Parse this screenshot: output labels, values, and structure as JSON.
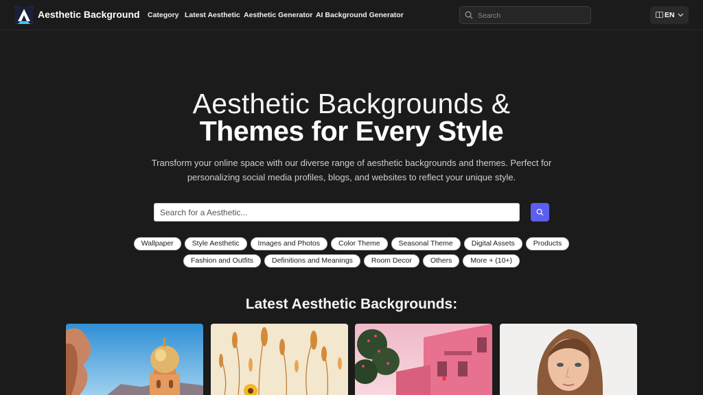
{
  "header": {
    "brand": "Aesthetic Background",
    "nav": [
      "Category",
      "Latest Aesthetic",
      "Aesthetic Generator",
      "AI Background Generator"
    ],
    "search_placeholder": "Search",
    "lang_code": "EN"
  },
  "hero": {
    "line1": "Aesthetic Backgrounds &",
    "line2": "Themes for Every Style",
    "subtitle": "Transform your online space with our diverse range of aesthetic backgrounds and themes. Perfect for personalizing social media profiles, blogs, and websites to reflect your unique style.",
    "search_placeholder": "Search for a Aesthetic..."
  },
  "tags_row1": [
    "Wallpaper",
    "Style Aesthetic",
    "Images and Photos",
    "Color Theme",
    "Seasonal Theme",
    "Digital Assets",
    "Products"
  ],
  "tags_row2": [
    "Fashion and Outfits",
    "Definitions and Meanings",
    "Room Decor",
    "Others",
    "More + (10+)"
  ],
  "section_title": "Latest Aesthetic Backgrounds:",
  "icons": {
    "logo": "brand-logo-icon",
    "header_search": "search-icon",
    "flag": "flag-icon",
    "chevron": "chevron-down-icon",
    "main_search": "search-icon"
  },
  "colors": {
    "background": "#1b1b1b",
    "accent": "#5b5ff0"
  }
}
